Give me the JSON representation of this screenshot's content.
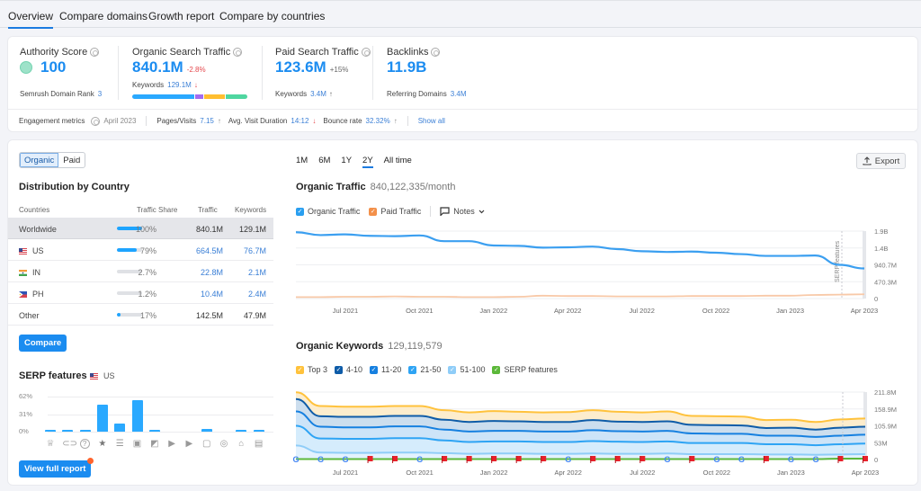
{
  "tabs": [
    {
      "label": "Overview",
      "active": true
    },
    {
      "label": "Compare domains",
      "active": false
    },
    {
      "label": "Growth report",
      "active": false
    },
    {
      "label": "Compare by countries",
      "active": false
    }
  ],
  "summary": {
    "authority": {
      "label": "Authority Score",
      "value": "100",
      "sub_label": "Semrush Domain Rank",
      "sub_value": "3"
    },
    "organic": {
      "label": "Organic Search Traffic",
      "value": "840.1M",
      "delta": "-2.8%",
      "sub_label": "Keywords",
      "sub_value": "129.1M",
      "sub_trend": "↓",
      "keyword_bar": [
        {
          "share": 0.55,
          "color": "#2aa9ff"
        },
        {
          "share": 0.07,
          "color": "#a36bf0"
        },
        {
          "share": 0.19,
          "color": "#ffbe30"
        },
        {
          "share": 0.19,
          "color": "#4fd6a0"
        }
      ]
    },
    "paid": {
      "label": "Paid Search Traffic",
      "value": "123.6M",
      "delta": "+15%",
      "sub_label": "Keywords",
      "sub_value": "3.4M",
      "sub_trend": "↑"
    },
    "backlinks": {
      "label": "Backlinks",
      "value": "11.9B",
      "sub_label": "Referring Domains",
      "sub_value": "3.4M"
    },
    "engagement": {
      "label": "Engagement metrics",
      "date": "April 2023",
      "pages_label": "Pages/Visits",
      "pages_value": "7.15",
      "pages_trend": "↑",
      "duration_label": "Avg. Visit Duration",
      "duration_value": "14:12",
      "duration_trend": "↓",
      "bounce_label": "Bounce rate",
      "bounce_value": "32.32%",
      "bounce_trend": "↑",
      "show_all": "Show all"
    }
  },
  "left": {
    "segment": [
      {
        "label": "Organic",
        "active": true
      },
      {
        "label": "Paid",
        "active": false
      }
    ],
    "distribution": {
      "title": "Distribution by Country",
      "headers": [
        "Countries",
        "Traffic Share",
        "Traffic",
        "Keywords"
      ],
      "rows": [
        {
          "country": "Worldwide",
          "flag": "",
          "share": "100%",
          "share_value": 1.0,
          "traffic": "840.1M",
          "keywords": "129.1M",
          "linked": false
        },
        {
          "country": "US",
          "flag": "us",
          "share": "79%",
          "share_value": 0.79,
          "traffic": "664.5M",
          "keywords": "76.7M",
          "linked": true
        },
        {
          "country": "IN",
          "flag": "in",
          "share": "2.7%",
          "share_value": 0.027,
          "traffic": "22.8M",
          "keywords": "2.1M",
          "linked": true
        },
        {
          "country": "PH",
          "flag": "ph",
          "share": "1.2%",
          "share_value": 0.012,
          "traffic": "10.4M",
          "keywords": "2.4M",
          "linked": true
        },
        {
          "country": "Other",
          "flag": "",
          "share": "17%",
          "share_value": 0.17,
          "traffic": "142.5M",
          "keywords": "47.9M",
          "linked": false
        }
      ]
    },
    "compare_button": "Compare",
    "serp": {
      "title": "SERP features",
      "country": "US",
      "y_ticks": [
        "62%",
        "31%",
        "0%"
      ],
      "view_full_report": "View full report"
    }
  },
  "right": {
    "periods": [
      {
        "label": "1M",
        "active": false
      },
      {
        "label": "6M",
        "active": false
      },
      {
        "label": "1Y",
        "active": false
      },
      {
        "label": "2Y",
        "active": true
      },
      {
        "label": "All time",
        "active": false
      }
    ],
    "export_label": "Export",
    "traffic": {
      "title": "Organic Traffic",
      "value": "840,122,335/month",
      "legend": [
        {
          "label": "Organic Traffic",
          "color": "#2a9ff0",
          "checked": true
        },
        {
          "label": "Paid Traffic",
          "color": "#f3904a",
          "checked": true
        }
      ],
      "notes_label": "Notes",
      "annotation": "SERP features"
    },
    "keywords": {
      "title": "Organic Keywords",
      "value": "129,119,579",
      "legend": [
        {
          "label": "Top 3",
          "color": "#ffc23c"
        },
        {
          "label": "4-10",
          "color": "#0e5ca8"
        },
        {
          "label": "11-20",
          "color": "#1680e0"
        },
        {
          "label": "21-50",
          "color": "#2ea4f4"
        },
        {
          "label": "51-100",
          "color": "#8fcdf8"
        },
        {
          "label": "SERP features",
          "color": "#5cb83a"
        }
      ]
    }
  },
  "chart_data": [
    {
      "type": "bar",
      "title": "SERP features (US)",
      "categories": [
        "Featured snippet",
        "Sitelinks",
        "People also ask",
        "Reviews",
        "Top stories",
        "Image",
        "Image pack",
        "Video",
        "Featured video",
        "Knowledge panel",
        "Local pack",
        "Scholarly",
        "Related questions"
      ],
      "icons": [
        "crown",
        "link",
        "question",
        "star",
        "layout",
        "image",
        "image-pack",
        "play",
        "video",
        "comment",
        "pin",
        "graduation",
        "document"
      ],
      "values": [
        1,
        1,
        1,
        47,
        14,
        55,
        1,
        0,
        0,
        5,
        0,
        1,
        1
      ],
      "ylim": [
        0,
        62
      ],
      "y_ticks": [
        "0%",
        "31%",
        "62%"
      ],
      "ylabel": "%"
    },
    {
      "type": "line",
      "title": "Organic Traffic",
      "x": [
        "May 2021",
        "Jun 2021",
        "Jul 2021",
        "Aug 2021",
        "Sep 2021",
        "Oct 2021",
        "Nov 2021",
        "Dec 2021",
        "Jan 2022",
        "Feb 2022",
        "Mar 2022",
        "Apr 2022",
        "May 2022",
        "Jun 2022",
        "Jul 2022",
        "Aug 2022",
        "Sep 2022",
        "Oct 2022",
        "Nov 2022",
        "Dec 2022",
        "Jan 2023",
        "Feb 2023",
        "Mar 2023",
        "Apr 2023"
      ],
      "x_ticks": [
        "Jul 2021",
        "Oct 2021",
        "Jan 2022",
        "Apr 2022",
        "Jul 2022",
        "Oct 2022",
        "Jan 2023",
        "Apr 2023"
      ],
      "y_ticks": [
        "0",
        "470.3M",
        "940.7M",
        "1.4B",
        "1.9B"
      ],
      "ylim": [
        0,
        1881000000
      ],
      "series": [
        {
          "name": "Organic Traffic",
          "color": "#3b9ff0",
          "values": [
            1850000000.0,
            1770000000.0,
            1790000000.0,
            1750000000.0,
            1740000000.0,
            1760000000.0,
            1600000000.0,
            1600000000.0,
            1480000000.0,
            1470000000.0,
            1420000000.0,
            1430000000.0,
            1450000000.0,
            1380000000.0,
            1320000000.0,
            1300000000.0,
            1310000000.0,
            1280000000.0,
            1240000000.0,
            1190000000.0,
            1190000000.0,
            1200000000.0,
            940000000.0,
            840000000.0
          ]
        },
        {
          "name": "Paid Traffic",
          "color": "#f8c9a8",
          "values": [
            40000000.0,
            40000000.0,
            50000000.0,
            50000000.0,
            60000000.0,
            50000000.0,
            50000000.0,
            40000000.0,
            40000000.0,
            50000000.0,
            80000000.0,
            70000000.0,
            70000000.0,
            60000000.0,
            60000000.0,
            60000000.0,
            70000000.0,
            70000000.0,
            70000000.0,
            80000000.0,
            80000000.0,
            100000000.0,
            110000000.0,
            120000000.0
          ]
        }
      ],
      "annotations": [
        {
          "x": "Apr 2023",
          "label": "SERP features"
        }
      ]
    },
    {
      "type": "area",
      "title": "Organic Keywords",
      "x": [
        "May 2021",
        "Jun 2021",
        "Jul 2021",
        "Aug 2021",
        "Sep 2021",
        "Oct 2021",
        "Nov 2021",
        "Dec 2021",
        "Jan 2022",
        "Feb 2022",
        "Mar 2022",
        "Apr 2022",
        "May 2022",
        "Jun 2022",
        "Jul 2022",
        "Aug 2022",
        "Sep 2022",
        "Oct 2022",
        "Nov 2022",
        "Dec 2022",
        "Jan 2023",
        "Feb 2023",
        "Mar 2023",
        "Apr 2023"
      ],
      "x_ticks": [
        "Jul 2021",
        "Oct 2021",
        "Jan 2022",
        "Apr 2022",
        "Jul 2022",
        "Oct 2022",
        "Jan 2023",
        "Apr 2023"
      ],
      "y_ticks": [
        "0",
        "53M",
        "105.9M",
        "158.9M",
        "211.8M"
      ],
      "ylim": [
        0,
        211.8
      ],
      "yunit": "M",
      "series": [
        {
          "name": "Top 3",
          "color": "#ffc23c",
          "values": [
            211,
            168,
            166,
            166,
            168,
            168,
            155,
            148,
            152,
            150,
            148,
            149,
            155,
            150,
            148,
            151,
            137,
            136,
            135,
            124,
            125,
            118,
            126,
            129
          ]
        },
        {
          "name": "4-10",
          "color": "#0e5ca8",
          "values": [
            190,
            136,
            134,
            134,
            137,
            137,
            125,
            118,
            121,
            120,
            118,
            118,
            124,
            119,
            118,
            120,
            109,
            108,
            107,
            99,
            100,
            94,
            100,
            103
          ]
        },
        {
          "name": "11-20",
          "color": "#1680e0",
          "values": [
            151,
            103,
            101,
            101,
            104,
            104,
            94,
            88,
            90,
            90,
            88,
            88,
            92,
            89,
            88,
            90,
            82,
            81,
            81,
            75,
            75,
            71,
            75,
            78
          ]
        },
        {
          "name": "21-50",
          "color": "#2ea4f4",
          "values": [
            106,
            66,
            65,
            65,
            67,
            67,
            60,
            55,
            57,
            57,
            55,
            55,
            58,
            56,
            55,
            57,
            52,
            52,
            52,
            48,
            48,
            45,
            48,
            50
          ]
        },
        {
          "name": "51-100",
          "color": "#8fcdf8",
          "values": [
            44,
            22,
            21,
            21,
            22,
            22,
            20,
            18,
            19,
            19,
            18,
            18,
            19,
            18,
            18,
            19,
            17,
            17,
            17,
            16,
            16,
            15,
            16,
            17
          ]
        },
        {
          "name": "SERP features",
          "color": "#5cb83a",
          "values": [
            1,
            1,
            1,
            1,
            1,
            1,
            1,
            1,
            1,
            1,
            1,
            1,
            1,
            1,
            1,
            1,
            1,
            1,
            1,
            1,
            1,
            1,
            2,
            2
          ]
        }
      ],
      "markers": [
        "google",
        "google",
        "google",
        "flag",
        "flag",
        "google",
        "flag",
        "flag",
        "flag",
        "flag",
        "flag",
        "google",
        "flag",
        "flag",
        "flag",
        "google",
        "flag",
        "google",
        "google",
        "flag",
        "google",
        "google",
        "flag",
        "flag"
      ]
    }
  ]
}
